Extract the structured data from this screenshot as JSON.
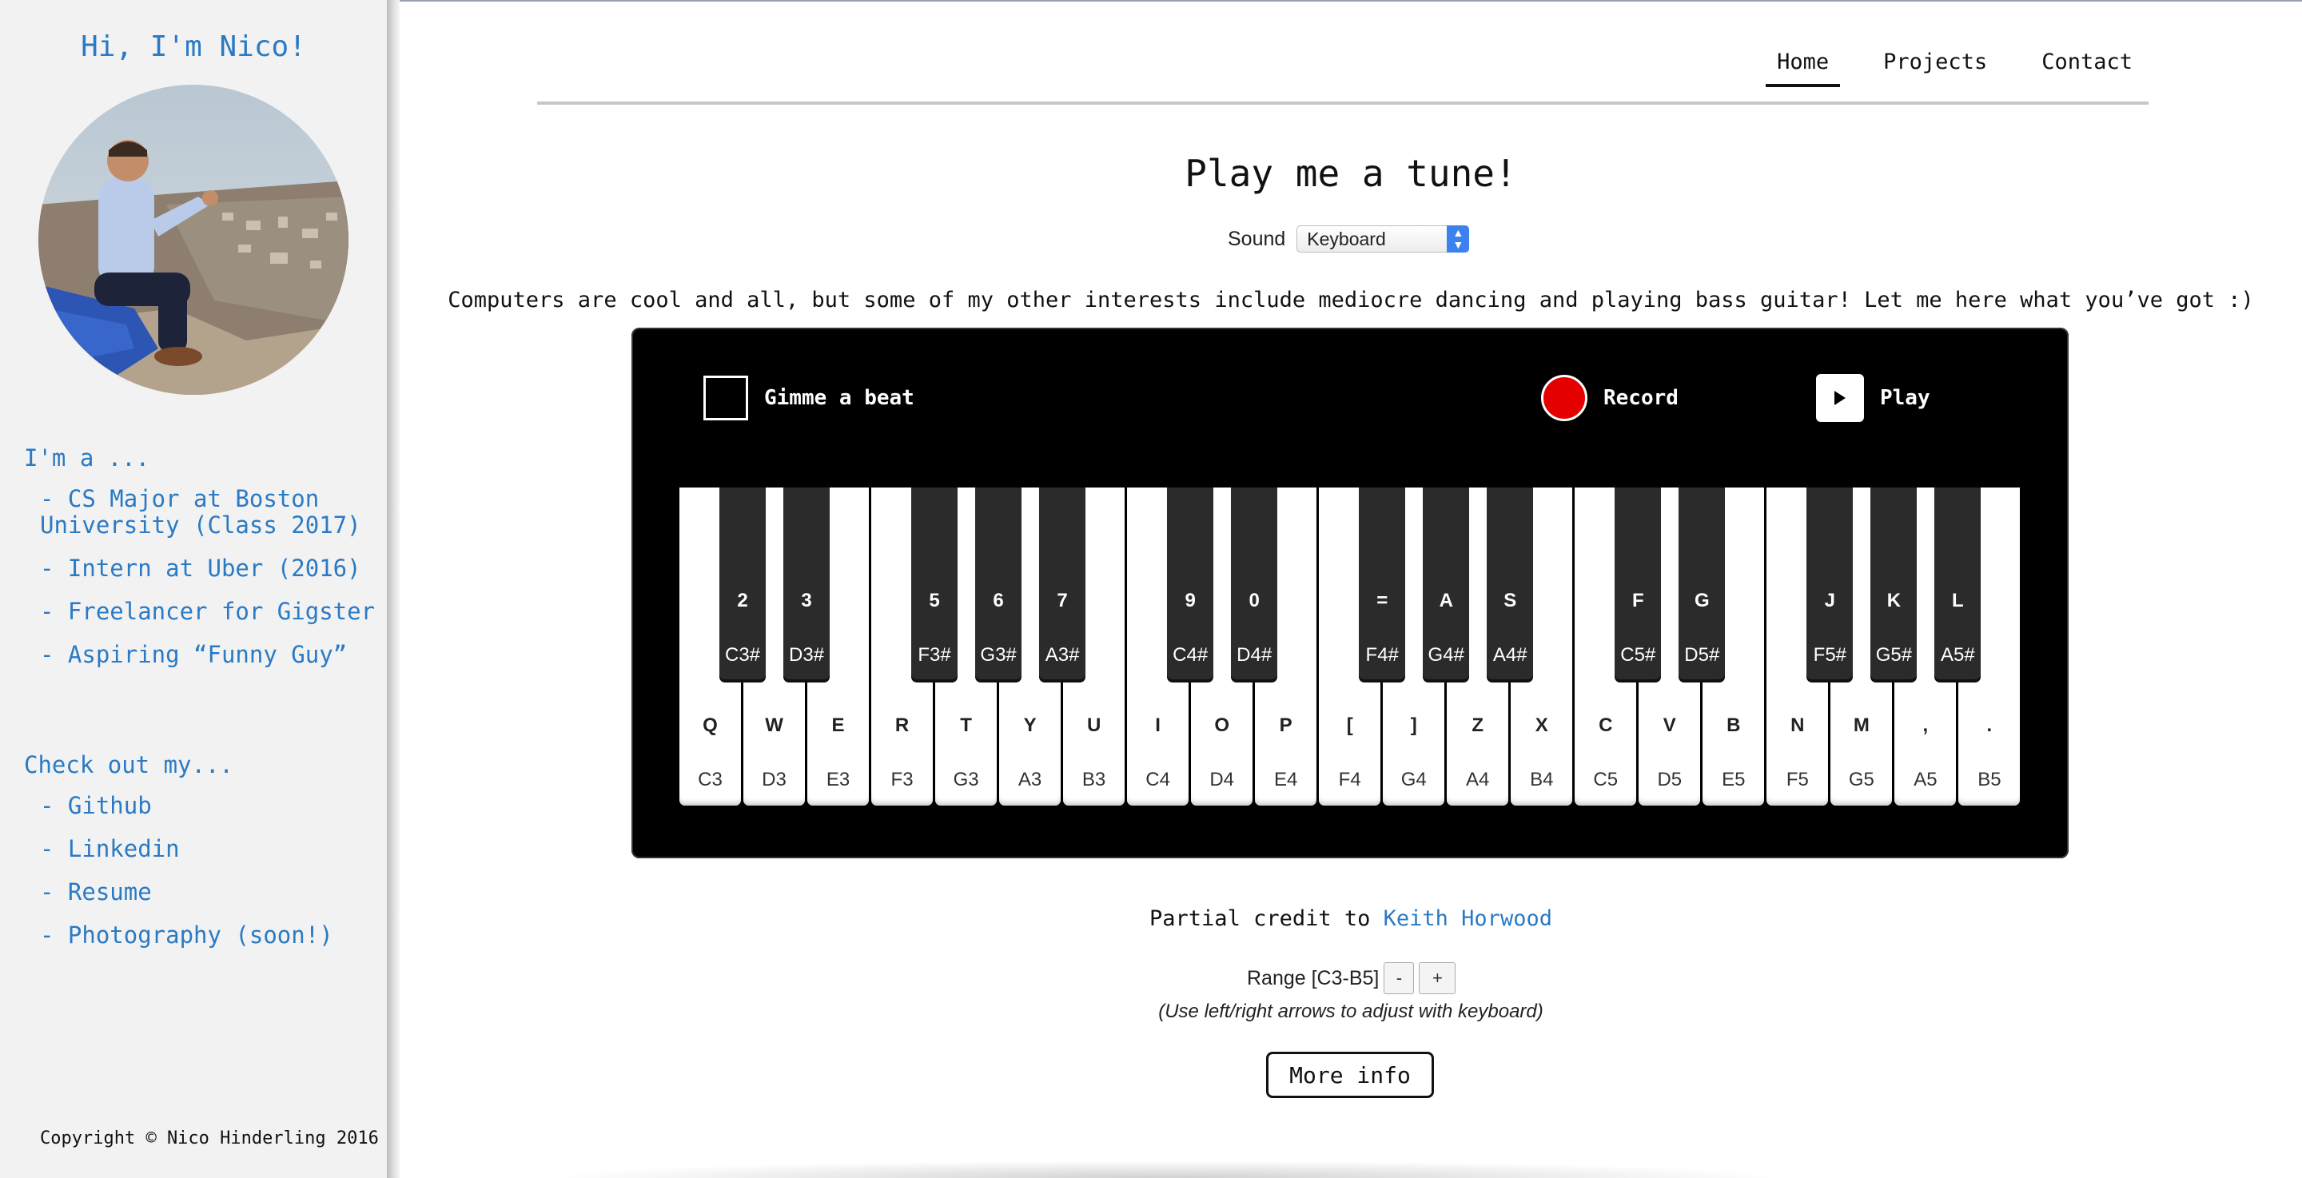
{
  "sidebar": {
    "greeting": "Hi, I'm Nico!",
    "im_a_heading": "I'm a ...",
    "im_a_items": [
      "- CS Major at Boston University (Class 2017)",
      "- Intern at Uber (2016)",
      "- Freelancer for Gigster",
      "- Aspiring “Funny Guy”"
    ],
    "check_heading": "Check out my...",
    "check_items": [
      "- Github",
      "- Linkedin",
      "- Resume",
      "- Photography (soon!)"
    ],
    "copyright": "Copyright © Nico Hinderling 2016",
    "link_color": "#2a7ac4"
  },
  "nav": {
    "items": [
      "Home",
      "Projects",
      "Contact"
    ],
    "active": "Home"
  },
  "main": {
    "title": "Play me a tune!",
    "sound_label": "Sound",
    "sound_value": "Keyboard",
    "intro": "Computers are cool and all, but some of my other interests include mediocre dancing and playing bass guitar! Let me here what you’ve got :)"
  },
  "piano": {
    "controls": {
      "beat_label": "Gimme a beat",
      "record_label": "Record",
      "play_label": "Play"
    },
    "record_color": "#e50000",
    "white_keys": [
      {
        "key": "Q",
        "note": "C3"
      },
      {
        "key": "W",
        "note": "D3"
      },
      {
        "key": "E",
        "note": "E3"
      },
      {
        "key": "R",
        "note": "F3"
      },
      {
        "key": "T",
        "note": "G3"
      },
      {
        "key": "Y",
        "note": "A3"
      },
      {
        "key": "U",
        "note": "B3"
      },
      {
        "key": "I",
        "note": "C4"
      },
      {
        "key": "O",
        "note": "D4"
      },
      {
        "key": "P",
        "note": "E4"
      },
      {
        "key": "[",
        "note": "F4"
      },
      {
        "key": "]",
        "note": "G4"
      },
      {
        "key": "Z",
        "note": "A4"
      },
      {
        "key": "X",
        "note": "B4"
      },
      {
        "key": "C",
        "note": "C5"
      },
      {
        "key": "V",
        "note": "D5"
      },
      {
        "key": "B",
        "note": "E5"
      },
      {
        "key": "N",
        "note": "F5"
      },
      {
        "key": "M",
        "note": "G5"
      },
      {
        "key": ",",
        "note": "A5"
      },
      {
        "key": ".",
        "note": "B5"
      }
    ],
    "black_keys": [
      {
        "key": "2",
        "note": "C3#",
        "after": 0
      },
      {
        "key": "3",
        "note": "D3#",
        "after": 1
      },
      {
        "key": "5",
        "note": "F3#",
        "after": 3
      },
      {
        "key": "6",
        "note": "G3#",
        "after": 4
      },
      {
        "key": "7",
        "note": "A3#",
        "after": 5
      },
      {
        "key": "9",
        "note": "C4#",
        "after": 7
      },
      {
        "key": "0",
        "note": "D4#",
        "after": 8
      },
      {
        "key": "=",
        "note": "F4#",
        "after": 10
      },
      {
        "key": "A",
        "note": "G4#",
        "after": 11
      },
      {
        "key": "S",
        "note": "A4#",
        "after": 12
      },
      {
        "key": "F",
        "note": "C5#",
        "after": 14
      },
      {
        "key": "G",
        "note": "D5#",
        "after": 15
      },
      {
        "key": "J",
        "note": "F5#",
        "after": 17
      },
      {
        "key": "K",
        "note": "G5#",
        "after": 18
      },
      {
        "key": "L",
        "note": "A5#",
        "after": 19
      }
    ]
  },
  "footer": {
    "credit_prefix": "Partial credit to",
    "credit_link": "Keith Horwood",
    "range_label": "Range [C3-B5]",
    "range_minus": "-",
    "range_plus": "+",
    "range_hint": "(Use left/right arrows to adjust with keyboard)",
    "more_info": "More info"
  }
}
